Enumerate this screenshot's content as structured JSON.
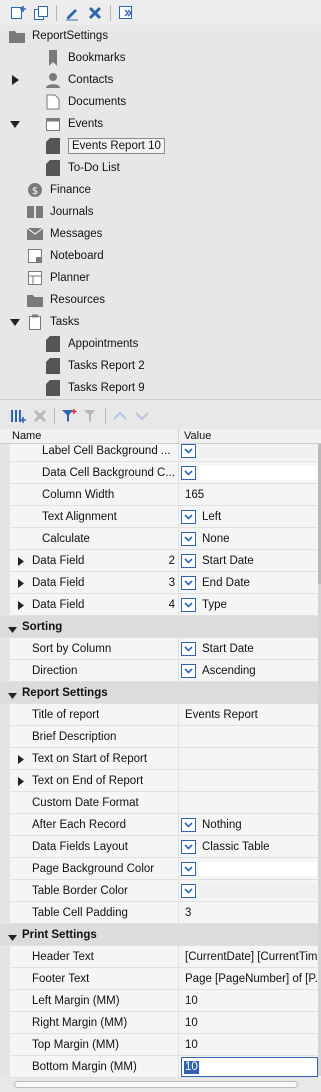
{
  "tree": {
    "root": "ReportSettings",
    "items": [
      {
        "label": "Bookmarks"
      },
      {
        "label": "Contacts"
      },
      {
        "label": "Documents"
      },
      {
        "label": "Events"
      },
      {
        "label": "Events Report 10"
      },
      {
        "label": "To-Do List"
      },
      {
        "label": "Finance"
      },
      {
        "label": "Journals"
      },
      {
        "label": "Messages"
      },
      {
        "label": "Noteboard"
      },
      {
        "label": "Planner"
      },
      {
        "label": "Resources"
      },
      {
        "label": "Tasks"
      },
      {
        "label": "Appointments"
      },
      {
        "label": "Tasks Report 2"
      },
      {
        "label": "Tasks Report 9"
      }
    ]
  },
  "grid": {
    "header_name": "Name",
    "header_value": "Value",
    "rows": [
      {
        "name": "Label Cell Background ...",
        "value": ""
      },
      {
        "name": "Data Cell Background C...",
        "value": ""
      },
      {
        "name": "Column Width",
        "value": "165"
      },
      {
        "name": "Text Alignment",
        "value": "Left"
      },
      {
        "name": "Calculate",
        "value": "None"
      },
      {
        "name": "Data Field",
        "index": "2",
        "value": "Start Date"
      },
      {
        "name": "Data Field",
        "index": "3",
        "value": "End Date"
      },
      {
        "name": "Data Field",
        "index": "4",
        "value": "Type"
      },
      {
        "name": "Sorting"
      },
      {
        "name": "Sort by Column",
        "value": "Start Date"
      },
      {
        "name": "Direction",
        "value": "Ascending"
      },
      {
        "name": "Report Settings"
      },
      {
        "name": "Title of report",
        "value": "Events Report"
      },
      {
        "name": "Brief Description",
        "value": ""
      },
      {
        "name": "Text on Start of Report",
        "value": ""
      },
      {
        "name": "Text on End of Report",
        "value": ""
      },
      {
        "name": "Custom Date Format",
        "value": ""
      },
      {
        "name": "After Each Record",
        "value": "Nothing"
      },
      {
        "name": "Data Fields Layout",
        "value": "Classic Table"
      },
      {
        "name": "Page Background Color",
        "value": ""
      },
      {
        "name": "Table Border Color",
        "value": ""
      },
      {
        "name": "Table Cell Padding",
        "value": "3"
      },
      {
        "name": "Print Settings"
      },
      {
        "name": "Header Text",
        "value": "[CurrentDate] [CurrentTim..."
      },
      {
        "name": "Footer Text",
        "value": "Page [PageNumber] of [P..."
      },
      {
        "name": "Left Margin (MM)",
        "value": "10"
      },
      {
        "name": "Right Margin (MM)",
        "value": "10"
      },
      {
        "name": "Top Margin (MM)",
        "value": "10"
      },
      {
        "name": "Bottom Margin (MM)",
        "value": "10"
      }
    ]
  },
  "colors": {
    "accent": "#2f64b5"
  }
}
